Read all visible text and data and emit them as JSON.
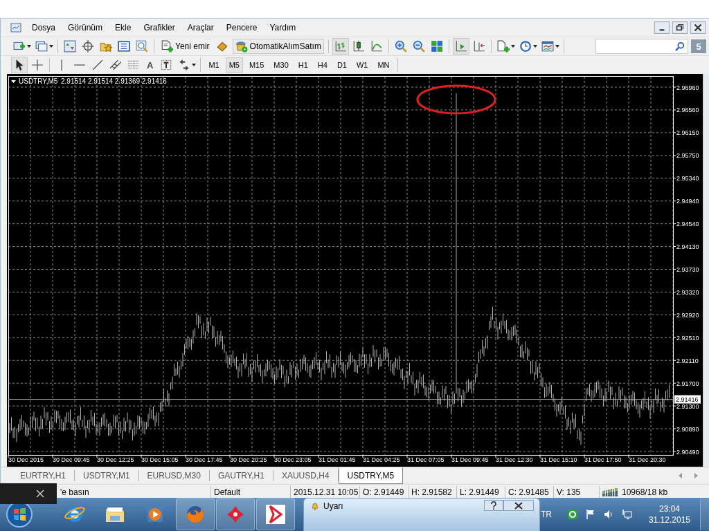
{
  "menu": [
    "Dosya",
    "Görünüm",
    "Ekle",
    "Grafikler",
    "Araçlar",
    "Pencere",
    "Yardım"
  ],
  "toolbar": {
    "new_order": "Yeni emir",
    "auto_trading": "OtomatikAlımSatım",
    "notification_count": "5"
  },
  "drawing_tools": {
    "text_tool": "A"
  },
  "timeframes": [
    {
      "label": "M1",
      "selected": false
    },
    {
      "label": "M5",
      "selected": true
    },
    {
      "label": "M15",
      "selected": false
    },
    {
      "label": "M30",
      "selected": false
    },
    {
      "label": "H1",
      "selected": false
    },
    {
      "label": "H4",
      "selected": false
    },
    {
      "label": "D1",
      "selected": false
    },
    {
      "label": "W1",
      "selected": false
    },
    {
      "label": "MN",
      "selected": false
    }
  ],
  "chart": {
    "symbol": "USDTRY,M5",
    "ohlc": "2.91514 2.91514 2.91369 2.91416",
    "current_price": "2.91416",
    "price_labels": [
      "2.96960",
      "2.96560",
      "2.96150",
      "2.95750",
      "2.95340",
      "2.94940",
      "2.94540",
      "2.94130",
      "2.93730",
      "2.93320",
      "2.92920",
      "2.92510",
      "2.92110",
      "2.91700",
      "2.91300",
      "2.90890",
      "2.90490"
    ],
    "time_labels": [
      "30 Dec 2015",
      "30 Dec 09:45",
      "30 Dec 12:25",
      "30 Dec 15:05",
      "30 Dec 17:45",
      "30 Dec 20:25",
      "30 Dec 23:05",
      "31 Dec 01:45",
      "31 Dec 04:25",
      "31 Dec 07:05",
      "31 Dec 09:45",
      "31 Dec 12:30",
      "31 Dec 15:10",
      "31 Dec 17:50",
      "31 Dec 20:30"
    ]
  },
  "tabs": [
    {
      "label": "EURTRY,H1",
      "selected": false
    },
    {
      "label": "USDTRY,M1",
      "selected": false
    },
    {
      "label": "EURUSD,M30",
      "selected": false
    },
    {
      "label": "GAUTRY,H1",
      "selected": false
    },
    {
      "label": "XAUUSD,H4",
      "selected": false
    },
    {
      "label": "USDTRY,M5",
      "selected": true
    }
  ],
  "status_bar": {
    "hint": "'e basın",
    "profile": "Default",
    "time": "2015.12.31 10:05",
    "open": "O: 2.91449",
    "high": "H: 2.91582",
    "low": "L: 2.91449",
    "close": "C: 2.91485",
    "volume": "V: 135",
    "traffic": "10968/18 kb"
  },
  "alert_window": {
    "title": "Uyarı"
  },
  "taskbar": {
    "language": "TR",
    "time": "23:04",
    "date": "31.12.2015"
  }
}
